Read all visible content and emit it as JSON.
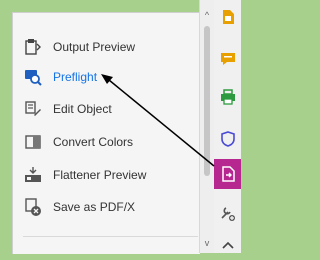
{
  "tools_panel": {
    "items": [
      {
        "label": "Output Preview",
        "icon": "output-preview-icon"
      },
      {
        "label": "Preflight",
        "icon": "preflight-icon"
      },
      {
        "label": "Edit Object",
        "icon": "edit-object-icon"
      },
      {
        "label": "Convert Colors",
        "icon": "convert-colors-icon"
      },
      {
        "label": "Flattener Preview",
        "icon": "flattener-preview-icon"
      },
      {
        "label": "Save as PDF/X",
        "icon": "save-as-pdfx-icon"
      }
    ]
  },
  "scrollbar": {
    "up_glyph": "^",
    "down_glyph": "v"
  },
  "right_toolbar": {
    "tools": [
      {
        "icon": "pdf-file-icon",
        "color": "#e8a000"
      },
      {
        "icon": "comment-icon",
        "color": "#e8a000"
      },
      {
        "icon": "print-production-icon",
        "color": "#2d9a3f"
      },
      {
        "icon": "protect-shield-icon",
        "color": "#4b4bd6"
      },
      {
        "icon": "export-pdf-icon",
        "color": "#ffffff",
        "active": true
      },
      {
        "icon": "more-tools-icon",
        "color": "#555555"
      }
    ]
  },
  "colors": {
    "background": "#a8d08d",
    "highlight_link": "#1473e6",
    "active_tool": "#b6278f"
  }
}
